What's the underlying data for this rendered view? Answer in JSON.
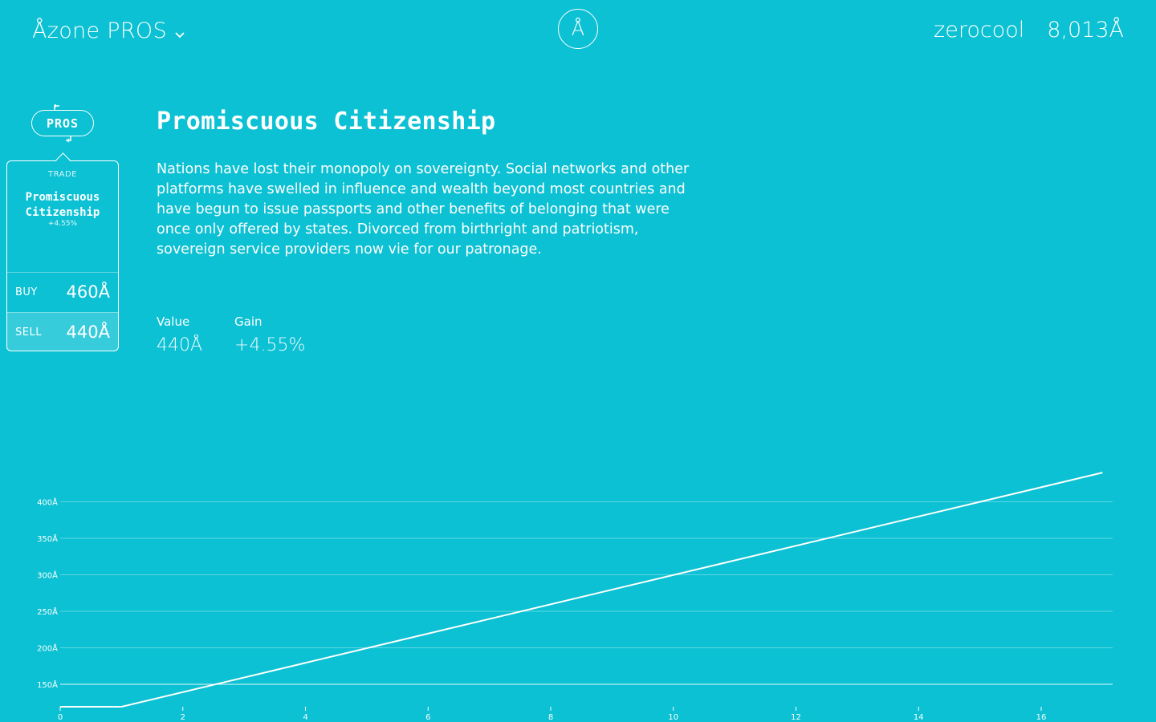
{
  "header": {
    "app_title": "Åzone PROS",
    "logo_glyph": "Å",
    "username": "zerocool",
    "balance": "8,013Å"
  },
  "badge": {
    "label": "PROS"
  },
  "trade_card": {
    "section_label": "TRADE",
    "title": "Promiscuous Citizenship",
    "gain": "+4.55%",
    "buy_label": "BUY",
    "buy_price": "460Å",
    "sell_label": "SELL",
    "sell_price": "440Å"
  },
  "main": {
    "title": "Promiscuous Citizenship",
    "description": "Nations have lost their monopoly on sovereignty. Social networks and other platforms have swelled in influence and wealth beyond most countries and have begun to issue passports and other benefits of belonging that were once only offered by states. Divorced from birthright and patriotism, sovereign service providers now vie for our patronage.",
    "stats": {
      "value_label": "Value",
      "value": "440Å",
      "gain_label": "Gain",
      "gain": "+4.55%"
    }
  },
  "chart_data": {
    "type": "line",
    "title": "",
    "xlabel": "",
    "ylabel": "",
    "grid": true,
    "xlim": [
      0,
      17.4
    ],
    "ylim": [
      120,
      440
    ],
    "xticks": [
      0,
      2,
      4,
      6,
      8,
      10,
      12,
      14,
      16
    ],
    "xtick_labels": [
      "0",
      "2",
      "4",
      "6",
      "8",
      "10",
      "12",
      "14",
      "16"
    ],
    "yticks": [
      150,
      200,
      250,
      300,
      350,
      400
    ],
    "ytick_labels": [
      "150Å",
      "200Å",
      "250Å",
      "300Å",
      "350Å",
      "400Å"
    ],
    "series": [
      {
        "x": [
          0,
          1,
          17
        ],
        "y": [
          120,
          120,
          440
        ]
      }
    ],
    "colors": {
      "line": "#ffffff",
      "grid": "#ffffff"
    }
  }
}
